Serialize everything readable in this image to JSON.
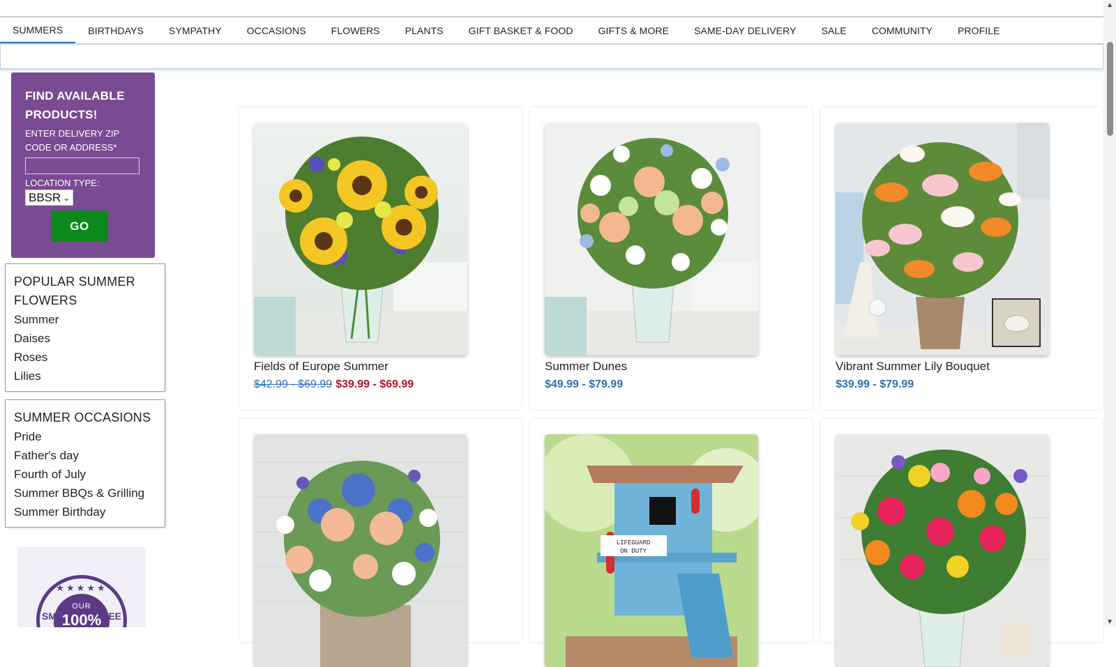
{
  "nav": {
    "items": [
      {
        "label": "SUMMERS",
        "active": true
      },
      {
        "label": "BIRTHDAYS"
      },
      {
        "label": "SYMPATHY"
      },
      {
        "label": "OCCASIONS"
      },
      {
        "label": "FLOWERS"
      },
      {
        "label": "PLANTS"
      },
      {
        "label": "GIFT BASKET & FOOD"
      },
      {
        "label": "GIFTS & MORE"
      },
      {
        "label": "SAME-DAY DELIVERY"
      },
      {
        "label": "SALE"
      },
      {
        "label": "COMMUNITY"
      },
      {
        "label": "PROFILE"
      }
    ]
  },
  "finder": {
    "title_line1": "FIND AVAILABLE",
    "title_line2": "PRODUCTS!",
    "zip_label_line1": "ENTER DELIVERY ZIP",
    "zip_label_line2": "CODE OR ADDRESS*",
    "zip_value": "",
    "location_label": "LOCATION TYPE:",
    "location_value": "BBSR",
    "go_label": "GO"
  },
  "popular": {
    "heading_line1": "POPULAR SUMMER",
    "heading_line2": "FLOWERS",
    "links": [
      "Summer",
      "Daises",
      "Roses",
      "Lilies"
    ]
  },
  "occasions": {
    "heading": "SUMMER OCCASIONS",
    "links": [
      "Pride",
      "Father's day",
      "Fourth of July",
      "Summer BBQs & Grilling",
      "Summer Birthday"
    ]
  },
  "badge": {
    "our": "OUR",
    "percent": "100%",
    "arc_left": "SM",
    "arc_right": "EE"
  },
  "products": [
    {
      "name": "Fields of Europe Summer",
      "old_price": "$42.99 - $69.99",
      "price": "$39.99 - $69.99",
      "on_sale": true,
      "image": "sunflower-bouquet-image"
    },
    {
      "name": "Summer Dunes",
      "price": "$49.99 - $79.99",
      "on_sale": false,
      "image": "peach-rose-bouquet-image"
    },
    {
      "name": "Vibrant Summer Lily Bouquet",
      "price": "$39.99 - $79.99",
      "on_sale": false,
      "image": "lily-bouquet-image"
    },
    {
      "name": "",
      "price": "",
      "image": "blue-peach-box-bouquet-image"
    },
    {
      "name": "",
      "price": "",
      "image": "lifeguard-birdhouse-image"
    },
    {
      "name": "",
      "price": "",
      "image": "bright-mixed-bouquet-image"
    }
  ],
  "birdhouse_sign_line1": "LIFEGUARD",
  "birdhouse_sign_line2": "ON DUTY"
}
